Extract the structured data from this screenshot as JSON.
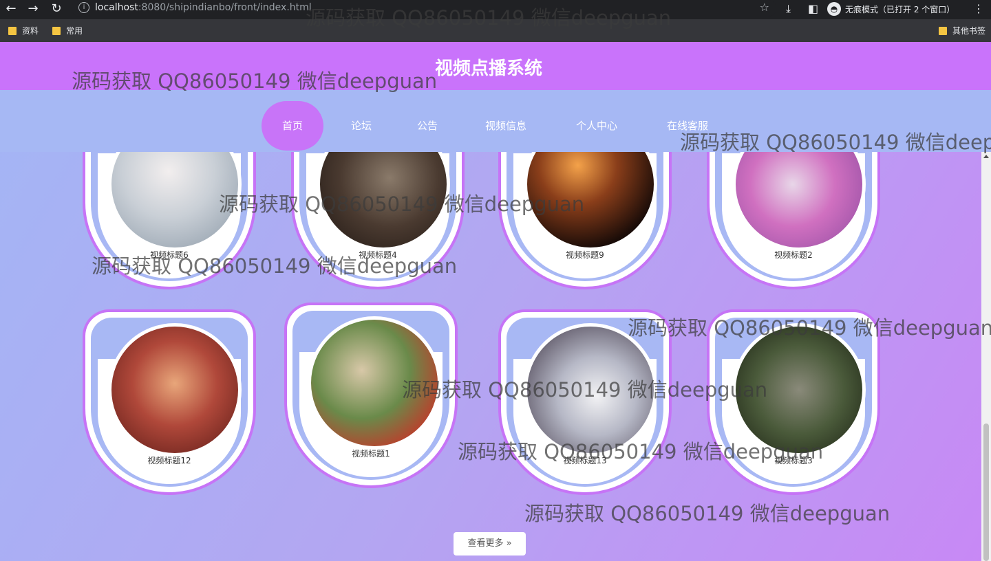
{
  "browser": {
    "url_host": "localhost",
    "url_rest": ":8080/shipindianbo/front/index.html",
    "incognito_label": "无痕模式（已打开 2 个窗口）",
    "bookmarks": [
      "资料",
      "常用"
    ],
    "other_bookmarks": "其他书签"
  },
  "site": {
    "title": "视频点播系统",
    "nav": [
      {
        "label": "首页",
        "active": true
      },
      {
        "label": "论坛"
      },
      {
        "label": "公告"
      },
      {
        "label": "视频信息"
      },
      {
        "label": "个人中心"
      },
      {
        "label": "在线客服"
      }
    ],
    "videos": [
      {
        "title": "视频标题6"
      },
      {
        "title": "视频标题4"
      },
      {
        "title": "视频标题9"
      },
      {
        "title": "视频标题2"
      },
      {
        "title": "视频标题12"
      },
      {
        "title": "视频标题1"
      },
      {
        "title": "视频标题13"
      },
      {
        "title": "视频标题3"
      }
    ],
    "more_label": "查看更多",
    "more_icon": "double-chevron-right-icon"
  },
  "watermark": "源码获取 QQ86050149 微信deepguan",
  "colors": {
    "header": "#c973fb",
    "nav": "#a6b8f4",
    "accent": "#c874f8",
    "card_border": "#c674f6"
  }
}
